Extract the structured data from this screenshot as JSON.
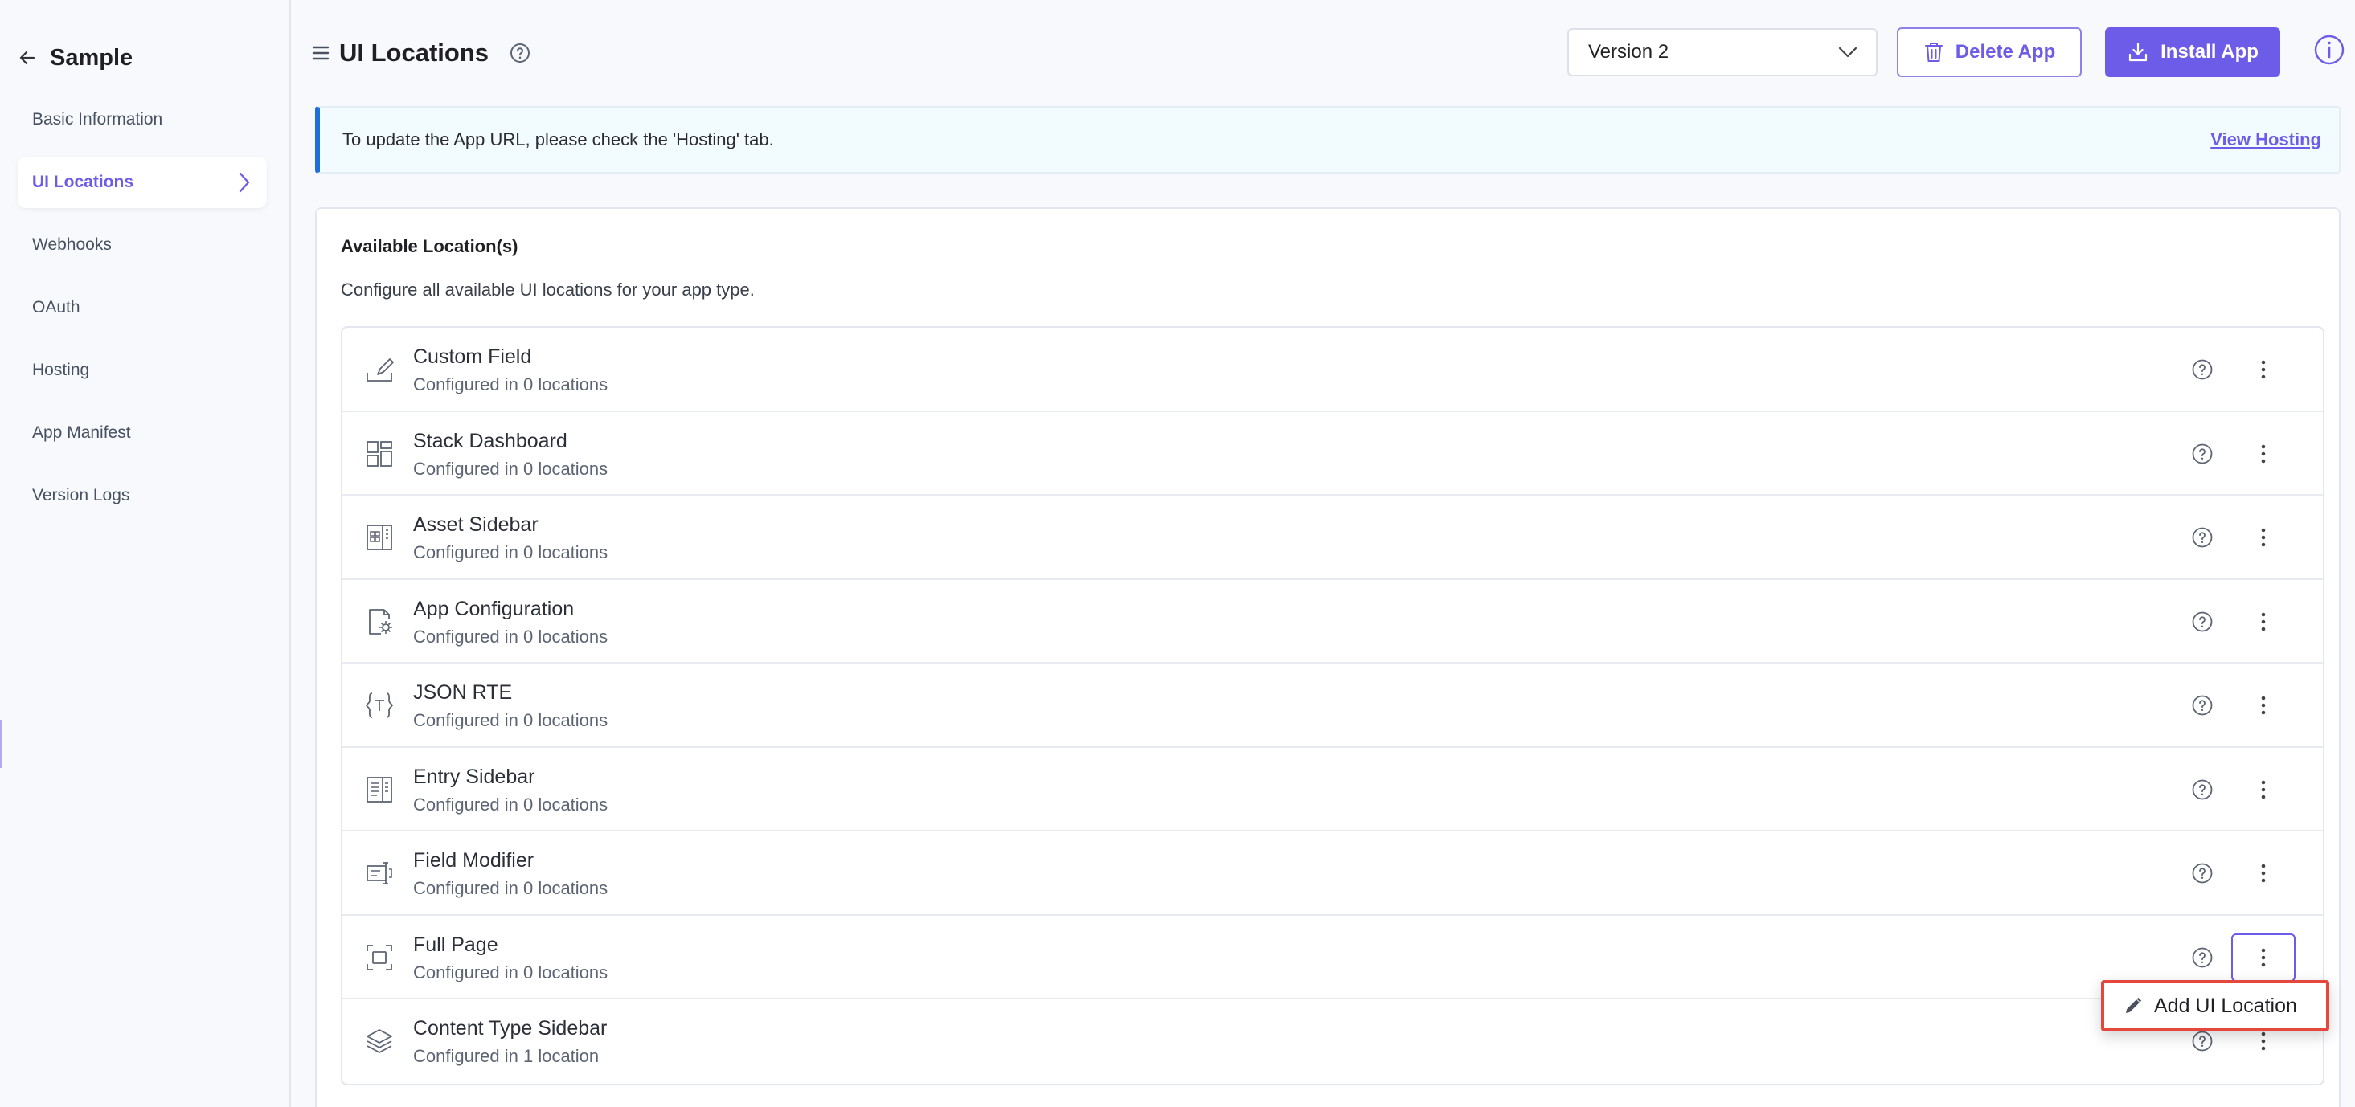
{
  "sidebar": {
    "title": "Sample",
    "items": [
      {
        "label": "Basic Information"
      },
      {
        "label": "UI Locations"
      },
      {
        "label": "Webhooks"
      },
      {
        "label": "OAuth"
      },
      {
        "label": "Hosting"
      },
      {
        "label": "App Manifest"
      },
      {
        "label": "Version Logs"
      }
    ],
    "active_index": 1
  },
  "header": {
    "title": "UI Locations",
    "version_selected": "Version 2",
    "delete_label": "Delete App",
    "install_label": "Install App"
  },
  "banner": {
    "text": "To update the App URL, please check the 'Hosting' tab.",
    "link": "View Hosting"
  },
  "card": {
    "title": "Available Location(s)",
    "subtitle": "Configure all available UI locations for your app type.",
    "locations": [
      {
        "name": "Custom Field",
        "count": "Configured in 0 locations",
        "icon": "custom-field-icon"
      },
      {
        "name": "Stack Dashboard",
        "count": "Configured in 0 locations",
        "icon": "dashboard-icon"
      },
      {
        "name": "Asset Sidebar",
        "count": "Configured in 0 locations",
        "icon": "asset-sidebar-icon"
      },
      {
        "name": "App Configuration",
        "count": "Configured in 0 locations",
        "icon": "app-config-icon"
      },
      {
        "name": "JSON RTE",
        "count": "Configured in 0 locations",
        "icon": "json-rte-icon"
      },
      {
        "name": "Entry Sidebar",
        "count": "Configured in 0 locations",
        "icon": "entry-sidebar-icon"
      },
      {
        "name": "Field Modifier",
        "count": "Configured in 0 locations",
        "icon": "field-modifier-icon"
      },
      {
        "name": "Full Page",
        "count": "Configured in 0 locations",
        "icon": "full-page-icon"
      },
      {
        "name": "Content Type Sidebar",
        "count": "Configured in 1 location",
        "icon": "layers-icon"
      }
    ],
    "focused_menu_index": 7
  },
  "dropdown": {
    "item_label": "Add UI Location"
  },
  "colors": {
    "accent": "#6c5ce7",
    "highlight": "#e5473c",
    "banner_border": "#1f6fd9"
  }
}
